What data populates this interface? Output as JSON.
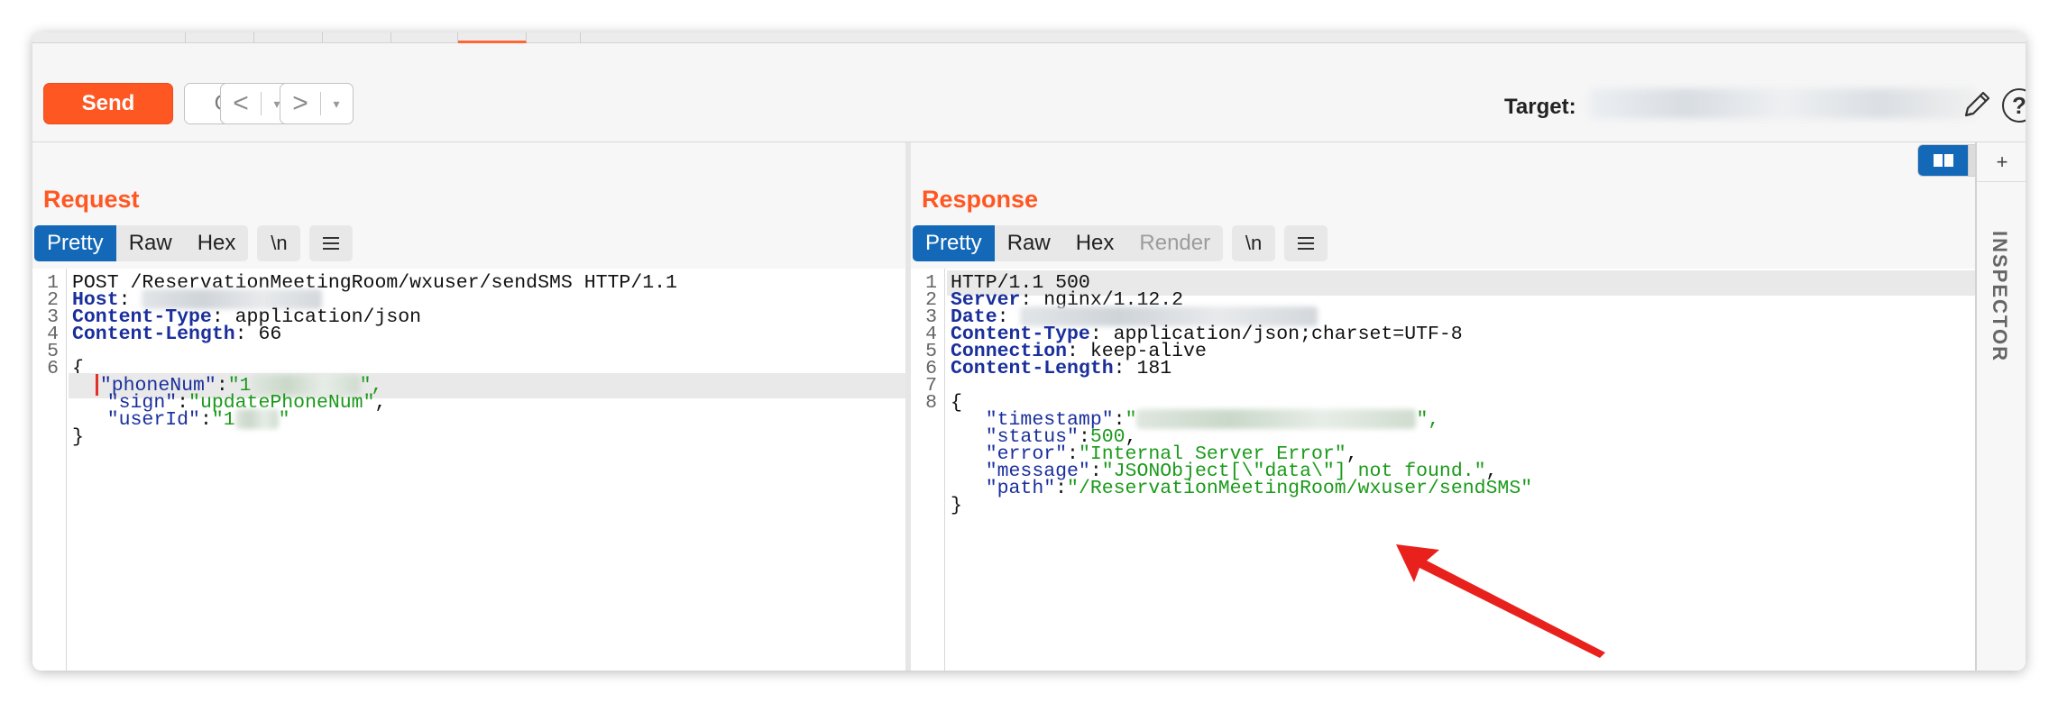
{
  "toolbar": {
    "send_label": "Send",
    "cancel_label": "Cancel",
    "back_glyph": "<",
    "forward_glyph": ">",
    "dropdown_glyph": "▾",
    "target_label": "Target:",
    "help_glyph": "?"
  },
  "icons": {
    "edit": "pencil-icon",
    "help": "help-icon",
    "layout_split": "split-view-icon",
    "layout_stacked": "stacked-view-icon",
    "layout_single": "single-view-icon",
    "menu": "hamburger-menu-icon"
  },
  "colors": {
    "accent": "#ff5722",
    "tab_active": "#1368b8",
    "header_key": "#1a2f9c",
    "json_string": "#1a9a1a"
  },
  "request": {
    "title": "Request",
    "tabs": {
      "pretty": "Pretty",
      "raw": "Raw",
      "hex": "Hex",
      "newline": "\\n"
    },
    "line_numbers": [
      "1",
      "2",
      "3",
      "4",
      "5",
      "6"
    ],
    "request_line": "POST /ReservationMeetingRoom/wxuser/sendSMS HTTP/1.1",
    "headers": [
      {
        "key": "Host",
        "value": ""
      },
      {
        "key": "Content-Type",
        "value": " application/json"
      },
      {
        "key": "Content-Length",
        "value": " 66"
      }
    ],
    "body_open": "{",
    "body_close": "}",
    "body": [
      {
        "key": "\"phoneNum\"",
        "value_prefix": "\"1",
        "value_suffix": "\","
      },
      {
        "key": "\"sign\"",
        "value_prefix": "\"updatePhoneNum\"",
        "value_suffix": ","
      },
      {
        "key": "\"userId\"",
        "value_prefix": "\"1",
        "value_suffix": "\""
      }
    ]
  },
  "response": {
    "title": "Response",
    "tabs": {
      "pretty": "Pretty",
      "raw": "Raw",
      "hex": "Hex",
      "render": "Render",
      "newline": "\\n"
    },
    "line_numbers": [
      "1",
      "2",
      "3",
      "4",
      "5",
      "6",
      "7",
      "8"
    ],
    "status_line": "HTTP/1.1 500",
    "headers": [
      {
        "key": "Server",
        "value": " nginx/1.12.2"
      },
      {
        "key": "Date",
        "value": ""
      },
      {
        "key": "Content-Type",
        "value": " application/json;charset=UTF-8"
      },
      {
        "key": "Connection",
        "value": " keep-alive"
      },
      {
        "key": "Content-Length",
        "value": " 181"
      }
    ],
    "body_open": "{",
    "body_close": "}",
    "body": [
      {
        "key": "\"timestamp\"",
        "value": "\"",
        "suffix": "\","
      },
      {
        "key": "\"status\"",
        "value": "500",
        "suffix": ","
      },
      {
        "key": "\"error\"",
        "value": "\"Internal Server Error\"",
        "suffix": ","
      },
      {
        "key": "\"message\"",
        "value": "\"JSONObject[\\\"data\\\"] not found.\"",
        "suffix": ","
      },
      {
        "key": "\"path\"",
        "value": "\"/ReservationMeetingRoom/wxuser/sendSMS\"",
        "suffix": ""
      }
    ]
  },
  "inspector": {
    "label": "INSPECTOR",
    "toggle_glyph": "+"
  }
}
